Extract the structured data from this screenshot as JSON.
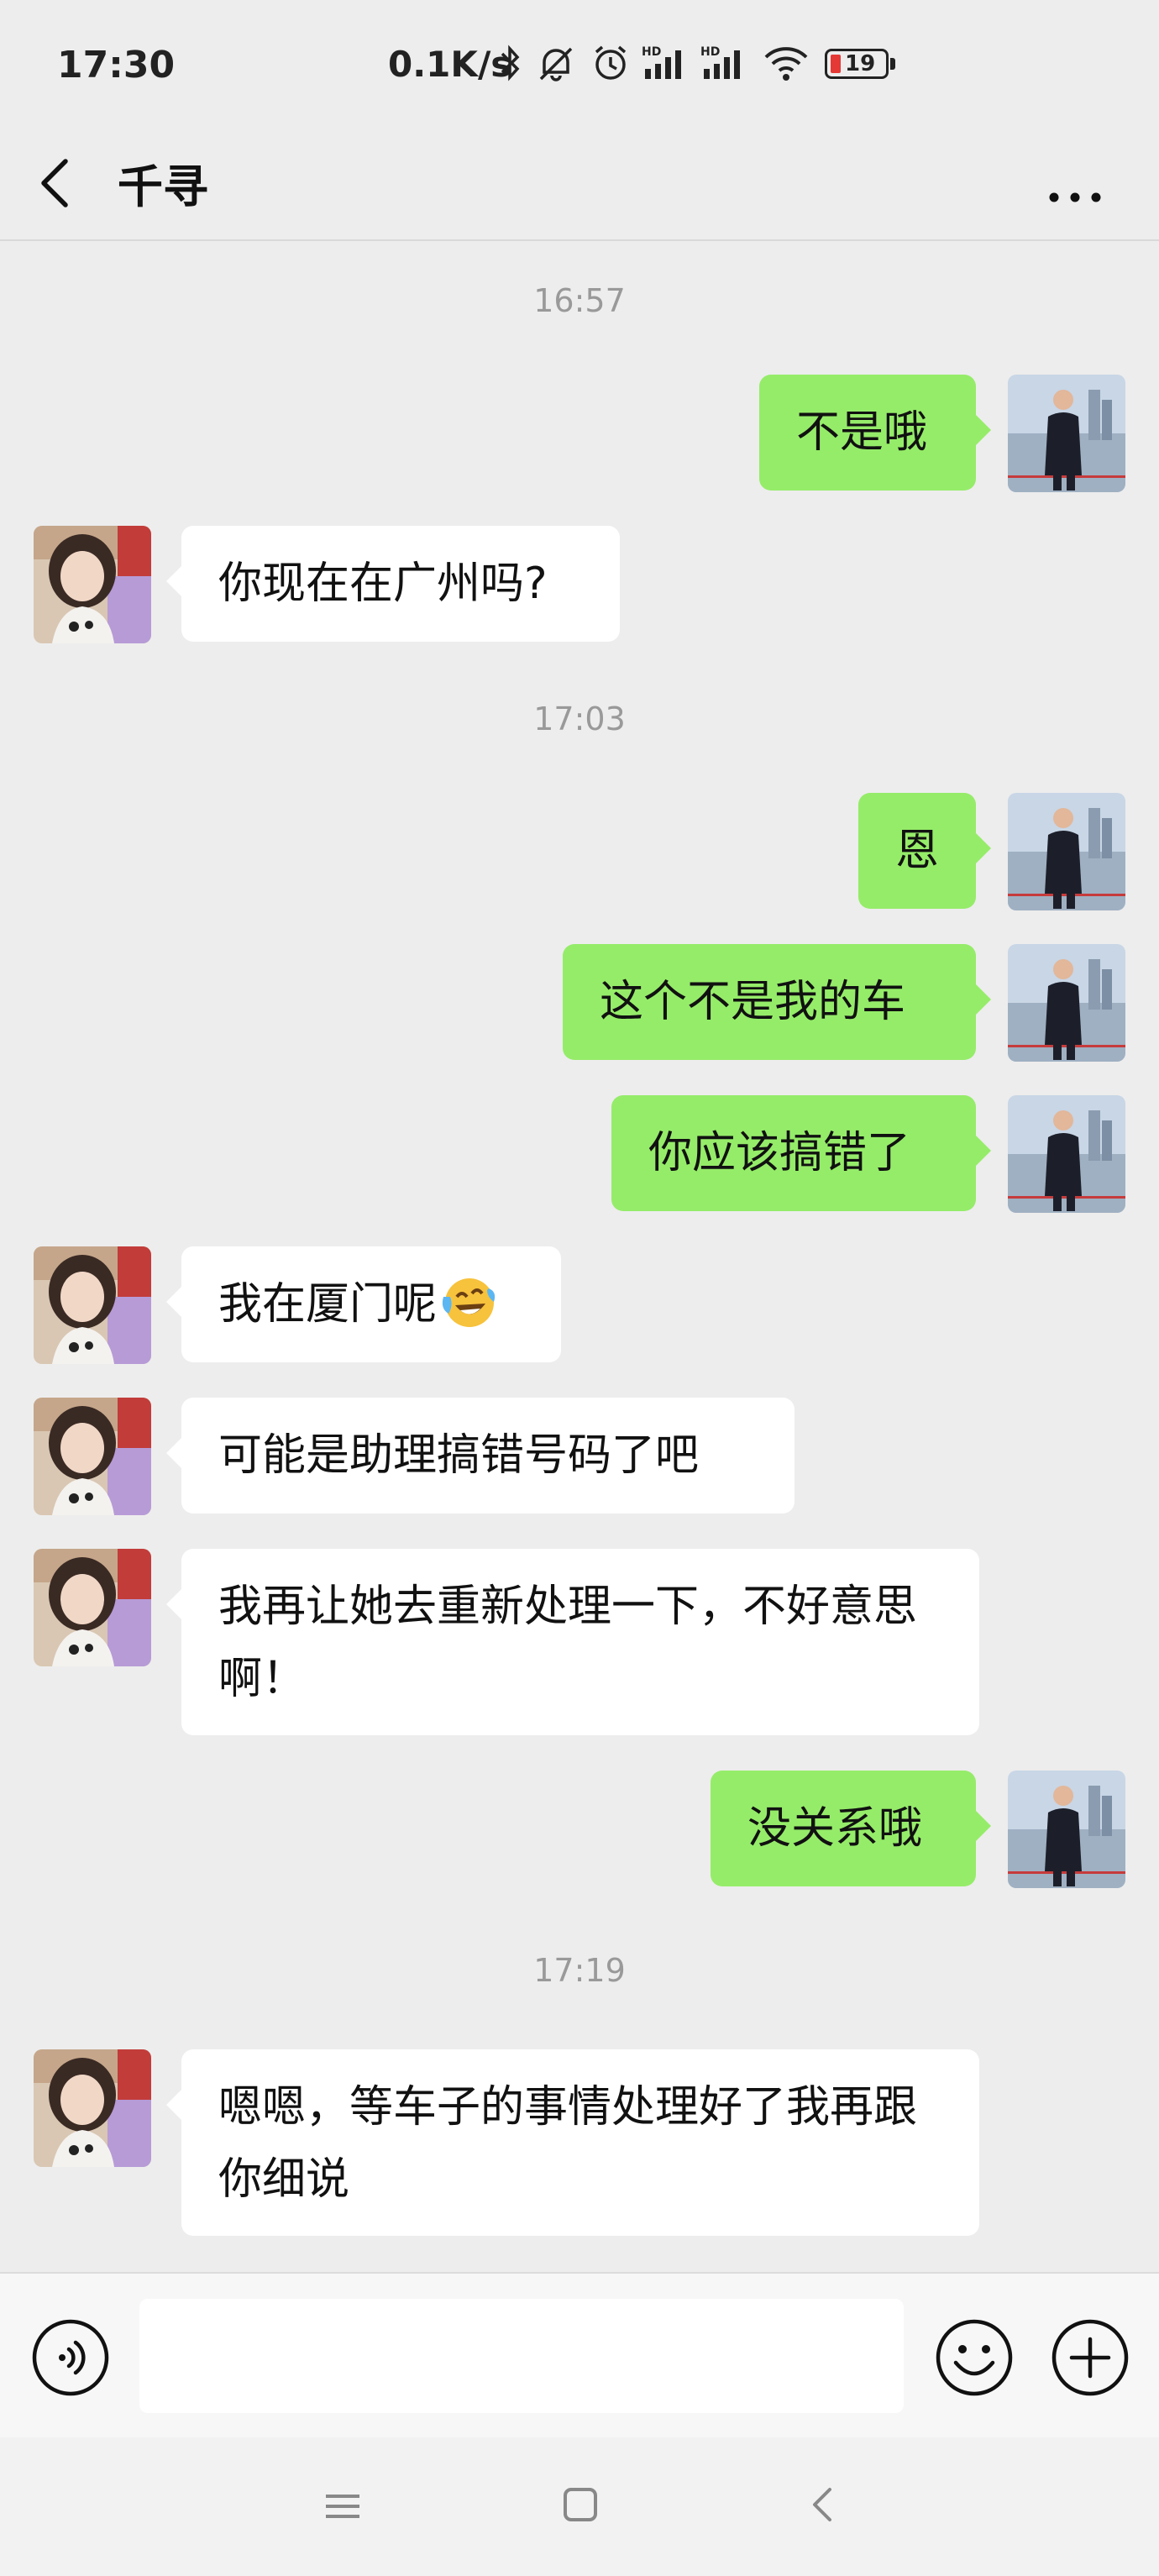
{
  "status_bar": {
    "time": "17:30",
    "net_speed": "0.1K/s",
    "battery": "19",
    "icons": [
      "bluetooth-icon",
      "mute-icon",
      "alarm-icon",
      "hd-signal-icon",
      "hd-signal-icon",
      "wifi-icon",
      "battery-icon"
    ]
  },
  "header": {
    "title": "千寻",
    "back_icon": "chevron-left-icon",
    "more_icon": "more-dots-icon"
  },
  "timestamps": {
    "t1": "16:57",
    "t2": "17:03",
    "t3": "17:19"
  },
  "messages": [
    {
      "side": "right",
      "text": "不是哦"
    },
    {
      "side": "left",
      "text": "你现在在广州吗?"
    },
    {
      "side": "right",
      "text": "恩"
    },
    {
      "side": "right",
      "text": "这个不是我的车"
    },
    {
      "side": "right",
      "text": "你应该搞错了"
    },
    {
      "side": "left",
      "text": "我在厦门呢",
      "emoji": "laughing-crying-face-icon"
    },
    {
      "side": "left",
      "text": "可能是助理搞错号码了吧"
    },
    {
      "side": "left",
      "text": "我再让她去重新处理一下，不好意思啊！"
    },
    {
      "side": "right",
      "text": "没关系哦"
    },
    {
      "side": "left",
      "text": "嗯嗯，等车子的事情处理好了我再跟你细说"
    }
  ],
  "input_bar": {
    "placeholder": "",
    "voice_icon": "voice-icon",
    "emoji_icon": "smiley-icon",
    "plus_icon": "plus-circle-icon"
  },
  "nav_bar": {
    "icons": [
      "menu-icon",
      "home-square-icon",
      "back-triangle-icon"
    ]
  },
  "colors": {
    "background": "#ededed",
    "outgoing_bubble": "#95ec69",
    "incoming_bubble": "#ffffff",
    "timestamp": "#999999",
    "battery_low": "#e53935"
  }
}
